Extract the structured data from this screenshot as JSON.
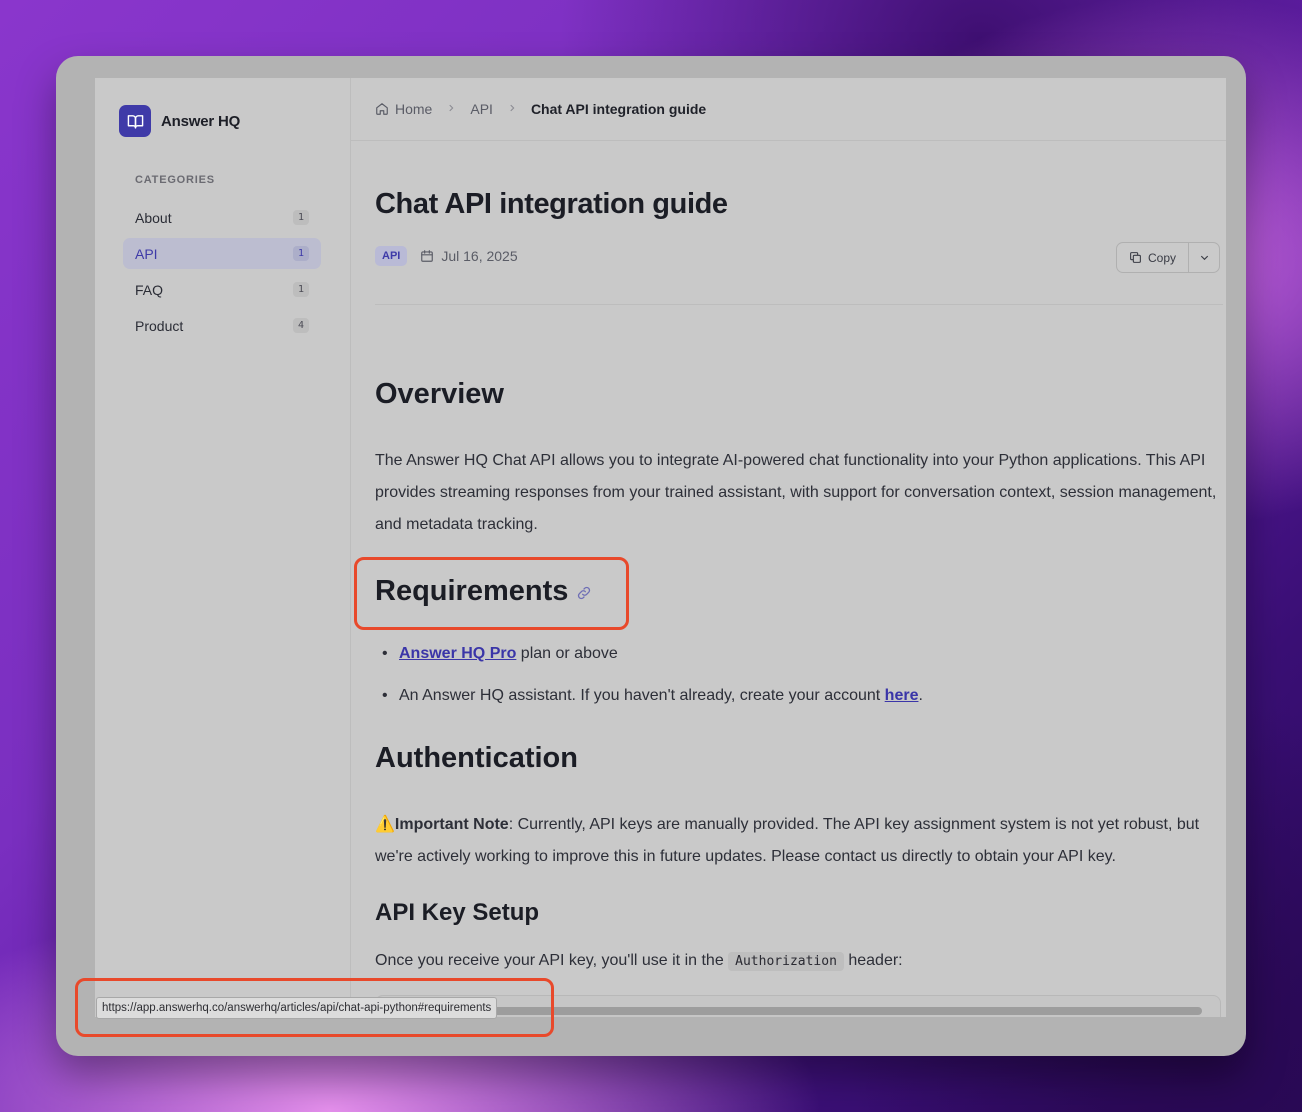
{
  "brand": {
    "name": "Answer HQ",
    "icon": "book-open-icon",
    "logo_color": "#3f3aa8"
  },
  "sidebar": {
    "heading": "CATEGORIES",
    "items": [
      {
        "label": "About",
        "count": "1",
        "active": false
      },
      {
        "label": "API",
        "count": "1",
        "active": true
      },
      {
        "label": "FAQ",
        "count": "1",
        "active": false
      },
      {
        "label": "Product",
        "count": "4",
        "active": false
      }
    ]
  },
  "breadcrumb": {
    "home": "Home",
    "section": "API",
    "current": "Chat API integration guide"
  },
  "article": {
    "title": "Chat API integration guide",
    "tag": "API",
    "date": "Jul 16, 2025",
    "copy_label": "Copy",
    "overview_heading": "Overview",
    "overview_text": "The Answer HQ Chat API allows you to integrate AI-powered chat functionality into your Python applications. This API provides streaming responses from your trained assistant, with support for conversation context, session management, and metadata tracking.",
    "requirements_heading": "Requirements",
    "req1_link": "Answer HQ Pro",
    "req1_text": " plan or above",
    "req2_text": "An Answer HQ assistant. If you haven't already, create your account ",
    "req2_link": "here",
    "req2_end": ".",
    "auth_heading": "Authentication",
    "note_icon": "⚠️",
    "note_label": "Important Note",
    "note_text": ": Currently, API keys are manually provided. The API key assignment system is not yet robust, but we're actively working to improve this in future updates. Please contact us directly to obtain your API key.",
    "apikey_heading": "API Key Setup",
    "apikey_text_before": "Once you receive your API key, you'll use it in the ",
    "apikey_code": "Authorization",
    "apikey_text_after": " header:"
  },
  "status_bar": {
    "url": "https://app.answerhq.co/answerhq/articles/api/chat-api-python#requirements"
  },
  "colors": {
    "accent": "#3e3aa8",
    "highlight": "#e8492b"
  }
}
